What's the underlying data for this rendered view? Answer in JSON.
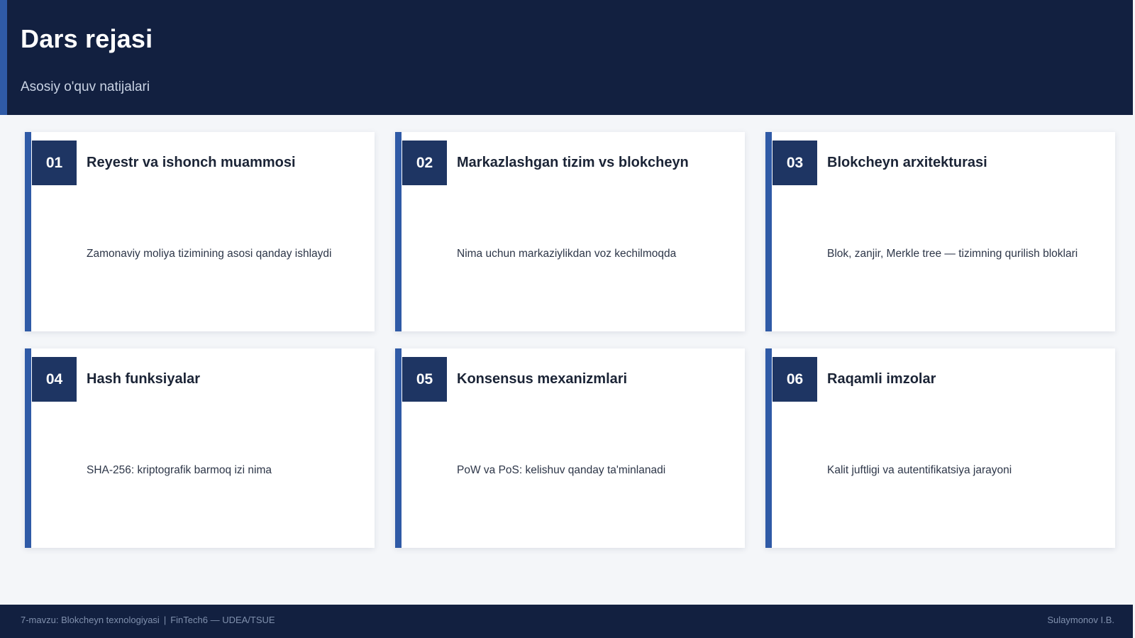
{
  "header": {
    "title": "Dars rejasi",
    "subtitle": "Asosiy o'quv natijalari"
  },
  "cards": [
    {
      "number": "01",
      "title": "Reyestr va ishonch muammosi",
      "description": "Zamonaviy moliya tizimining asosi qanday ishlaydi"
    },
    {
      "number": "02",
      "title": "Markazlashgan tizim vs blokcheyn",
      "description": "Nima uchun markaziylikdan voz kechilmoqda"
    },
    {
      "number": "03",
      "title": "Blokcheyn arxitekturasi",
      "description": "Blok, zanjir, Merkle tree — tizimning qurilish bloklari"
    },
    {
      "number": "04",
      "title": "Hash funksiyalar",
      "description": "SHA-256: kriptografik barmoq izi nima"
    },
    {
      "number": "05",
      "title": "Konsensus mexanizmlari",
      "description": "PoW va PoS: kelishuv qanday ta'minlanadi"
    },
    {
      "number": "06",
      "title": "Raqamli imzolar",
      "description": "Kalit juftligi va autentifikatsiya jarayoni"
    }
  ],
  "footer": {
    "topic": "7-mavzu: Blokcheyn texnologiyasi",
    "separator": "|",
    "course": "FinTech6 — UDEA/TSUE",
    "author": "Sulaymonov I.B."
  },
  "colors": {
    "header_bg": "#122040",
    "accent": "#2f5aa6",
    "number_badge": "#1e3563",
    "page_bg": "#f4f6f9"
  }
}
